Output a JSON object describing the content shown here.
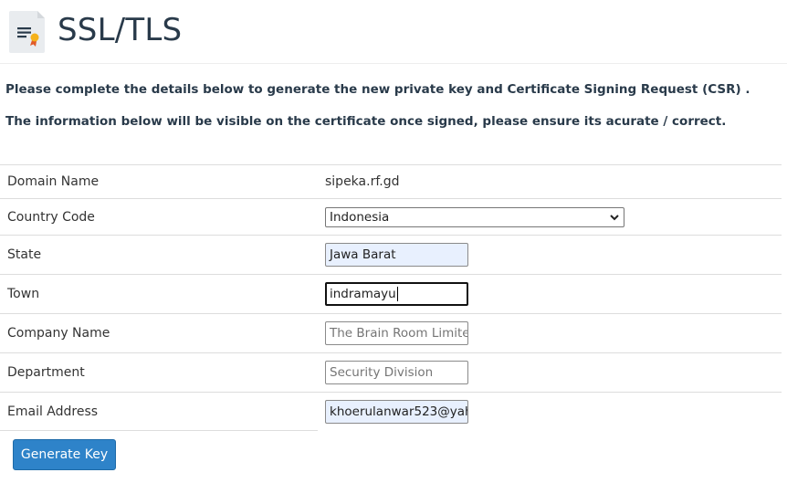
{
  "header": {
    "title": "SSL/TLS",
    "icon": "certificate-icon"
  },
  "intro": {
    "line1": "Please complete the details below to generate the new private key and Certificate Signing Request (CSR) .",
    "line2": "The information below will be visible on the certificate once signed, please ensure its acurate / correct."
  },
  "form": {
    "domain_name": {
      "label": "Domain Name",
      "value": "sipeka.rf.gd"
    },
    "country_code": {
      "label": "Country Code",
      "value": "Indonesia"
    },
    "state": {
      "label": "State",
      "value": "Jawa Barat"
    },
    "town": {
      "label": "Town",
      "value": "indramayu"
    },
    "company_name": {
      "label": "Company Name",
      "placeholder": "The Brain Room Limite"
    },
    "department": {
      "label": "Department",
      "placeholder": "Security Division"
    },
    "email_address": {
      "label": "Email Address",
      "value": "khoerulanwar523@yah"
    }
  },
  "actions": {
    "generate_key_label": "Generate Key"
  },
  "colors": {
    "title": "#293a4a",
    "button": "#2e83c9",
    "autofill": "#e8f0fe"
  }
}
